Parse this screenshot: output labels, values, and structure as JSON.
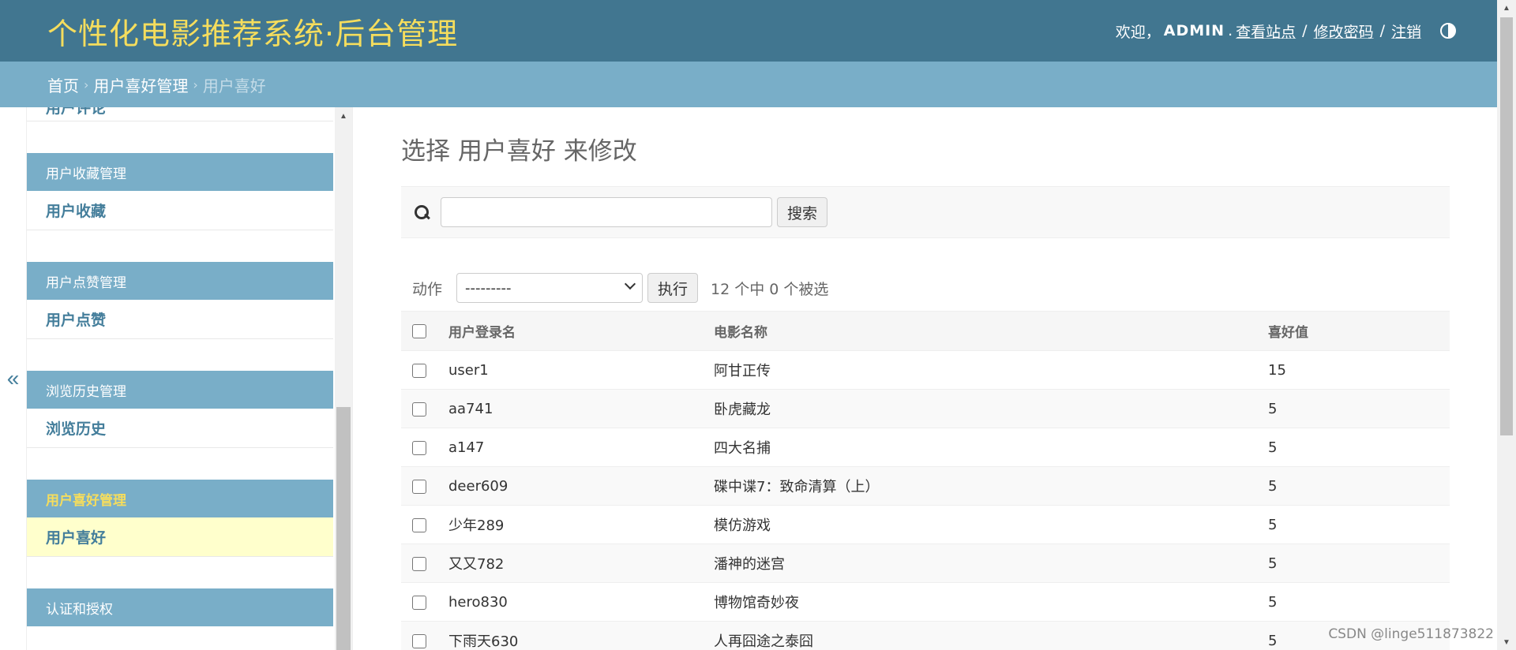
{
  "header": {
    "site_title": "个性化电影推荐系统·后台管理",
    "welcome": "欢迎，",
    "username": "ADMIN",
    "dot": ".",
    "view_site": "查看站点",
    "change_password": "修改密码",
    "logout": "注销",
    "separator": "/"
  },
  "breadcrumb": {
    "home": "首页",
    "app": "用户喜好管理",
    "current": "用户喜好",
    "sep": "›"
  },
  "sidebar": {
    "toggle": "«",
    "partial_item": "用户评论",
    "modules": [
      {
        "caption": "用户收藏管理",
        "item": "用户收藏",
        "active": false
      },
      {
        "caption": "用户点赞管理",
        "item": "用户点赞",
        "active": false
      },
      {
        "caption": "浏览历史管理",
        "item": "浏览历史",
        "active": false
      },
      {
        "caption": "用户喜好管理",
        "item": "用户喜好",
        "active": true
      },
      {
        "caption": "认证和授权",
        "item": "",
        "active": false
      }
    ]
  },
  "main": {
    "title": "选择 用户喜好 来修改",
    "search": {
      "value": "",
      "placeholder": "",
      "button": "搜索"
    },
    "actions": {
      "label": "动作",
      "selected": "---------",
      "go_button": "执行",
      "counter": "12 个中 0 个被选"
    },
    "table": {
      "headers": [
        "用户登录名",
        "电影名称",
        "喜好值"
      ],
      "rows": [
        [
          "user1",
          "阿甘正传",
          "15"
        ],
        [
          "aa741",
          "卧虎藏龙",
          "5"
        ],
        [
          "a147",
          "四大名捕",
          "5"
        ],
        [
          "deer609",
          "碟中谍7：致命清算（上）",
          "5"
        ],
        [
          "少年289",
          "模仿游戏",
          "5"
        ],
        [
          "又又782",
          "潘神的迷宫",
          "5"
        ],
        [
          "hero830",
          "博物馆奇妙夜",
          "5"
        ],
        [
          "下雨天630",
          "人再囧途之泰囧",
          "5"
        ]
      ]
    }
  },
  "watermark": "CSDN @linge511873822",
  "colors": {
    "header_bg": "#417690",
    "breadcrumb_bg": "#79aec8",
    "title_yellow": "#f5dd5d",
    "link_blue": "#447e9b",
    "active_row": "#ffffcc"
  }
}
